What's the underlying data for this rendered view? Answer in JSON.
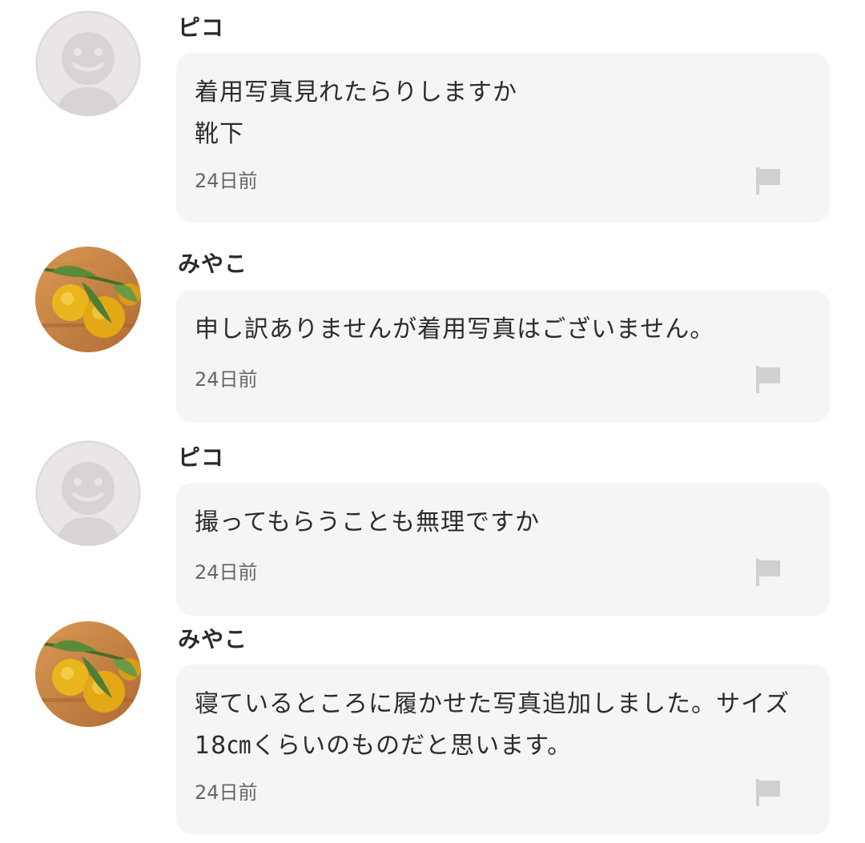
{
  "colors": {
    "bubble_bg": "#f5f5f5",
    "default_avatar_bg": "#ebe6e6",
    "default_avatar_fg": "#d9d4d4",
    "flag_icon": "#d0d0d0"
  },
  "comments": [
    {
      "author": "ピコ",
      "avatar": "default-avatar-icon",
      "text": "着用写真見れたらりしますか\n靴下",
      "time": "24日前",
      "report_icon": "flag-icon"
    },
    {
      "author": "みやこ",
      "avatar": "citrus-photo-avatar",
      "text": "申し訳ありませんが着用写真はございません。",
      "time": "24日前",
      "report_icon": "flag-icon"
    },
    {
      "author": "ピコ",
      "avatar": "default-avatar-icon",
      "text": "撮ってもらうことも無理ですか",
      "time": "24日前",
      "report_icon": "flag-icon"
    },
    {
      "author": "みやこ",
      "avatar": "citrus-photo-avatar",
      "text": "寝ているところに履かせた写真追加しました。サイズ18㎝くらいのものだと思います。",
      "time": "24日前",
      "report_icon": "flag-icon"
    }
  ]
}
